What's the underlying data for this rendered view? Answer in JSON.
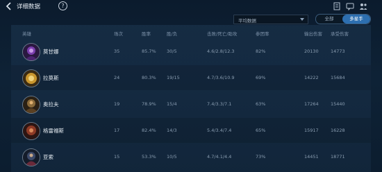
{
  "header": {
    "title": "详细数据",
    "help": "?"
  },
  "filter": {
    "selected": "平均数据"
  },
  "segmented": {
    "all": "全部",
    "multi": "多星手"
  },
  "table": {
    "columns": [
      "英雄",
      "场次",
      "胜率",
      "胜/负",
      "击败/死亡/助攻",
      "参团率",
      "输出伤害",
      "承受伤害"
    ],
    "rows": [
      {
        "avatar": "purple-hero-avatar",
        "name": "莫甘娜",
        "c": [
          "35",
          "85.7%",
          "30/5",
          "4.6/2.8/12.3",
          "82%",
          "20130",
          "14773"
        ]
      },
      {
        "avatar": "gold-hero-avatar",
        "name": "拉莫斯",
        "c": [
          "24",
          "80.3%",
          "19/15",
          "4.7/3.6/10.9",
          "69%",
          "14222",
          "15684"
        ]
      },
      {
        "avatar": "bronze-hero-avatar",
        "name": "奥拉夫",
        "c": [
          "19",
          "78.9%",
          "15/4",
          "7.4/3.3/7.1",
          "63%",
          "17264",
          "15440"
        ]
      },
      {
        "avatar": "red-hero-avatar",
        "name": "格雷福斯",
        "c": [
          "17",
          "82.4%",
          "14/3",
          "5.4/3.4/7.4",
          "65%",
          "15917",
          "16228"
        ]
      },
      {
        "avatar": "blue-hero-avatar",
        "name": "亚索",
        "c": [
          "15",
          "53.3%",
          "10/5",
          "4.7/4.1/4.4",
          "73%",
          "14451",
          "18771"
        ]
      }
    ]
  }
}
